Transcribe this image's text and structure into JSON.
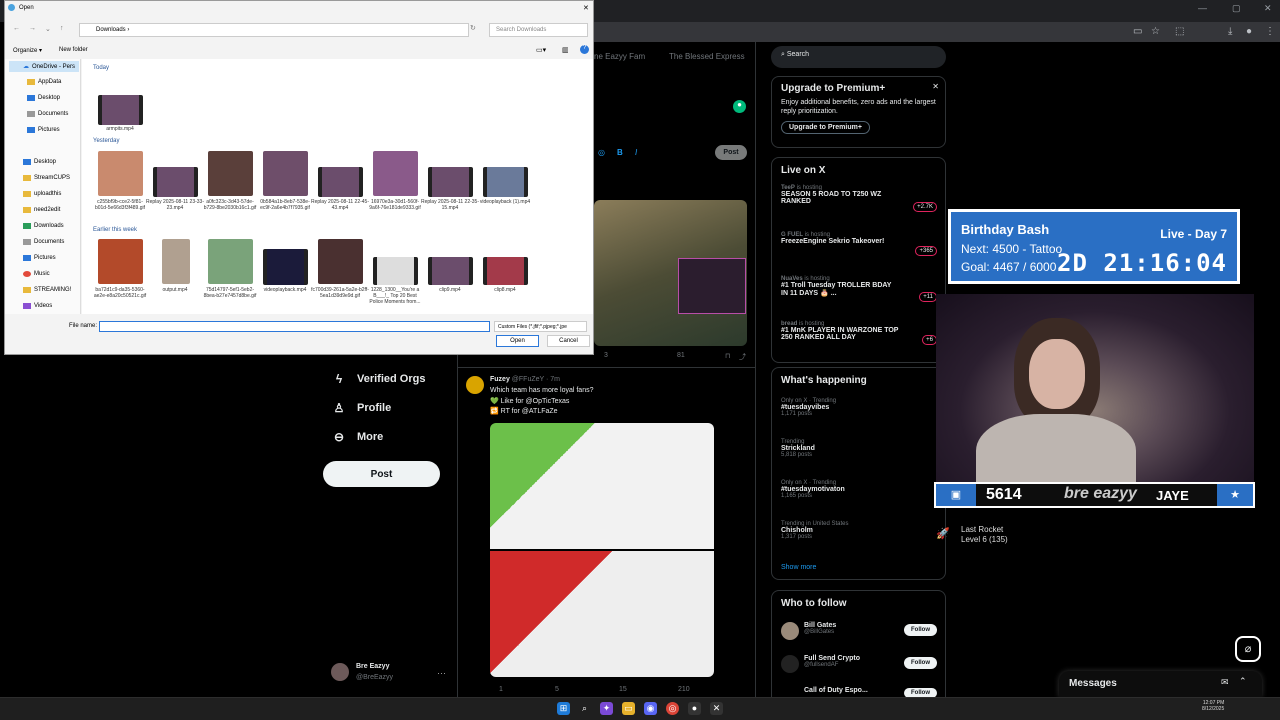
{
  "browser": {
    "address_placeholder": ""
  },
  "x": {
    "tabs": [
      "ne Eazyy Fam",
      "The Blessed Express"
    ],
    "compose": {
      "post_label": "Post"
    },
    "nav": [
      {
        "label": "Verified Orgs",
        "icon": "lightning-icon"
      },
      {
        "label": "Profile",
        "icon": "person-icon"
      },
      {
        "label": "More",
        "icon": "more-circle-icon"
      }
    ],
    "post_button": "Post",
    "account": {
      "name": "Bre Eazyy",
      "handle": "@BreEazyy"
    },
    "search_placeholder": "Search",
    "premium": {
      "title": "Upgrade to Premium+",
      "body": "Enjoy additional benefits, zero ads and the largest reply prioritization.",
      "button": "Upgrade to Premium+"
    },
    "live": {
      "title": "Live on X",
      "items": [
        {
          "user": "TeeP",
          "status": "is hosting",
          "text": "SEASON 5 ROAD TO T250 WZ RANKED",
          "count": "+2.7K"
        },
        {
          "user": "G FUEL",
          "status": "is hosting",
          "text": "FreezeEngine Sekrio Takeover!",
          "count": "+365"
        },
        {
          "user": "NuaVes",
          "status": "is hosting",
          "text": "#1 Troll Tuesday TROLLER BDAY IN 11 DAYS 🎂 ...",
          "count": "+11"
        },
        {
          "user": "bread",
          "status": "is hosting",
          "text": "#1 MnK PLAYER IN WARZONE TOP 250 RANKED ALL DAY",
          "count": "+6"
        }
      ]
    },
    "happening": {
      "title": "What's happening",
      "items": [
        {
          "meta": "Only on X · Trending",
          "topic": "#tuesdayvibes",
          "posts": "1,171 posts"
        },
        {
          "meta": "Trending",
          "topic": "Strickland",
          "posts": "5,818 posts"
        },
        {
          "meta": "Only on X · Trending",
          "topic": "#tuesdaymotivaton",
          "posts": "1,165 posts"
        },
        {
          "meta": "Trending in United States",
          "topic": "Chisholm",
          "posts": "1,317 posts"
        }
      ],
      "show_more": "Show more"
    },
    "follow": {
      "title": "Who to follow",
      "items": [
        {
          "name": "Bill Gates",
          "handle": "@BillGates",
          "button": "Follow"
        },
        {
          "name": "Full Send Crypto",
          "handle": "@fullsendAF",
          "button": "Follow"
        },
        {
          "name": "Call of Duty Espo...",
          "handle": "",
          "button": "Follow"
        }
      ]
    },
    "messages": "Messages",
    "tweet1": {
      "stats": [
        "3",
        "81"
      ]
    },
    "tweet2": {
      "name": "Fuzey",
      "handle": "@FFuZeY · 7m",
      "text": "Which team has more loyal fans?",
      "line1": "💚 Like for @OpTicTexas",
      "line2": "🔁 RT for @ATLFaZe",
      "stats": [
        "1",
        "5",
        "15",
        "210"
      ]
    }
  },
  "dialog": {
    "title": "Open",
    "breadcrumb": "Downloads",
    "search_placeholder": "Search Downloads",
    "organize": "Organize ▾",
    "new_folder": "New folder",
    "sidebar": [
      "OneDrive - Pers",
      "AppData",
      "Desktop",
      "Documents",
      "Pictures",
      "Desktop",
      "StreamCUPS",
      "uploadthis",
      "need2edit",
      "Downloads",
      "Documents",
      "Pictures",
      "Music",
      "STREAMING!",
      "Videos"
    ],
    "groups": {
      "today": "Today",
      "yesterday": "Yesterday",
      "earlier": "Earlier this week"
    },
    "today_files": [
      "armpits.mp4"
    ],
    "yesterday_files": [
      "c255bf9b-cce2-5f81-b01d-5e66d3f3f489.gif",
      "Replay 2025-08-11 23-33-23.mp4",
      "a0fc323c-3d43-57de-b729-8be2030b16c1.gif",
      "0b584a1b-8eb7-538e-ec9f-2a6e4b7f7935.gif",
      "Replay 2025-08-11 22-45-43.mp4",
      "16970e3a-30d1-560f-9a6f-76e181de9333.gif",
      "Replay 2025-08-11 22-35-15.mp4",
      "videoplayback (1).mp4"
    ],
    "earlier_files": [
      "ba72d1c9-da35-5360-ae2e-e8a20c50521c.gif",
      "output.mp4",
      "75d14797-5ef1-5eb2-8bea-b27e7457d8be.gif",
      "videoplayback.mp4",
      "fc700d39-261a-5a2e-b2ff-5ea1d39d9e9d.gif",
      "1228_1300__You're a B___!_ Top 20 Best Police Moments from...",
      "clip9.mp4",
      "clip8.mp4"
    ],
    "file_name_label": "File name:",
    "file_type": "Custom Files (*.jfif;*.pjpeg;*.jpe",
    "open": "Open",
    "cancel": "Cancel"
  },
  "overlay": {
    "title": "Birthday Bash",
    "live": "Live - Day 7",
    "next": "Next: 4500 - Tattoo",
    "goal": "Goal: 4467 / 6000",
    "timer": "2D  21:16:04",
    "points": "5614",
    "brand": "bre eazyy",
    "name": "JAYE",
    "rocket": {
      "line1": "Last Rocket",
      "line2": "Level 6  (135)"
    }
  },
  "tray": {
    "time": "12:07 PM",
    "date": "8/12/2025"
  }
}
